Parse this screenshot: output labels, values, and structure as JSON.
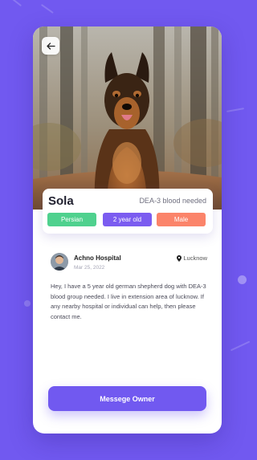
{
  "pet": {
    "name": "Sola",
    "blood_needed": "DEA-3 blood needed",
    "tags": {
      "breed": "Persian",
      "age": "2 year old",
      "gender": "Male"
    }
  },
  "post": {
    "owner_name": "Achno Hospital",
    "date": "Mar 25, 2022",
    "location": "Lucknow",
    "description": "Hey, I have a 5 year old german shepherd dog with DEA-3 blood group needed. I live in extension area of lucknow. If any nearby hospital or individual can help, then please contact me."
  },
  "actions": {
    "message_owner_label": "Messege Owner"
  },
  "icons": {
    "back": "arrow-left-icon",
    "location": "location-pin-icon"
  },
  "colors": {
    "background": "#7159f0",
    "accent": "#7b5cf0",
    "tag_breed": "#4fd18e",
    "tag_age": "#7b5cf0",
    "tag_gender": "#fb846a"
  }
}
